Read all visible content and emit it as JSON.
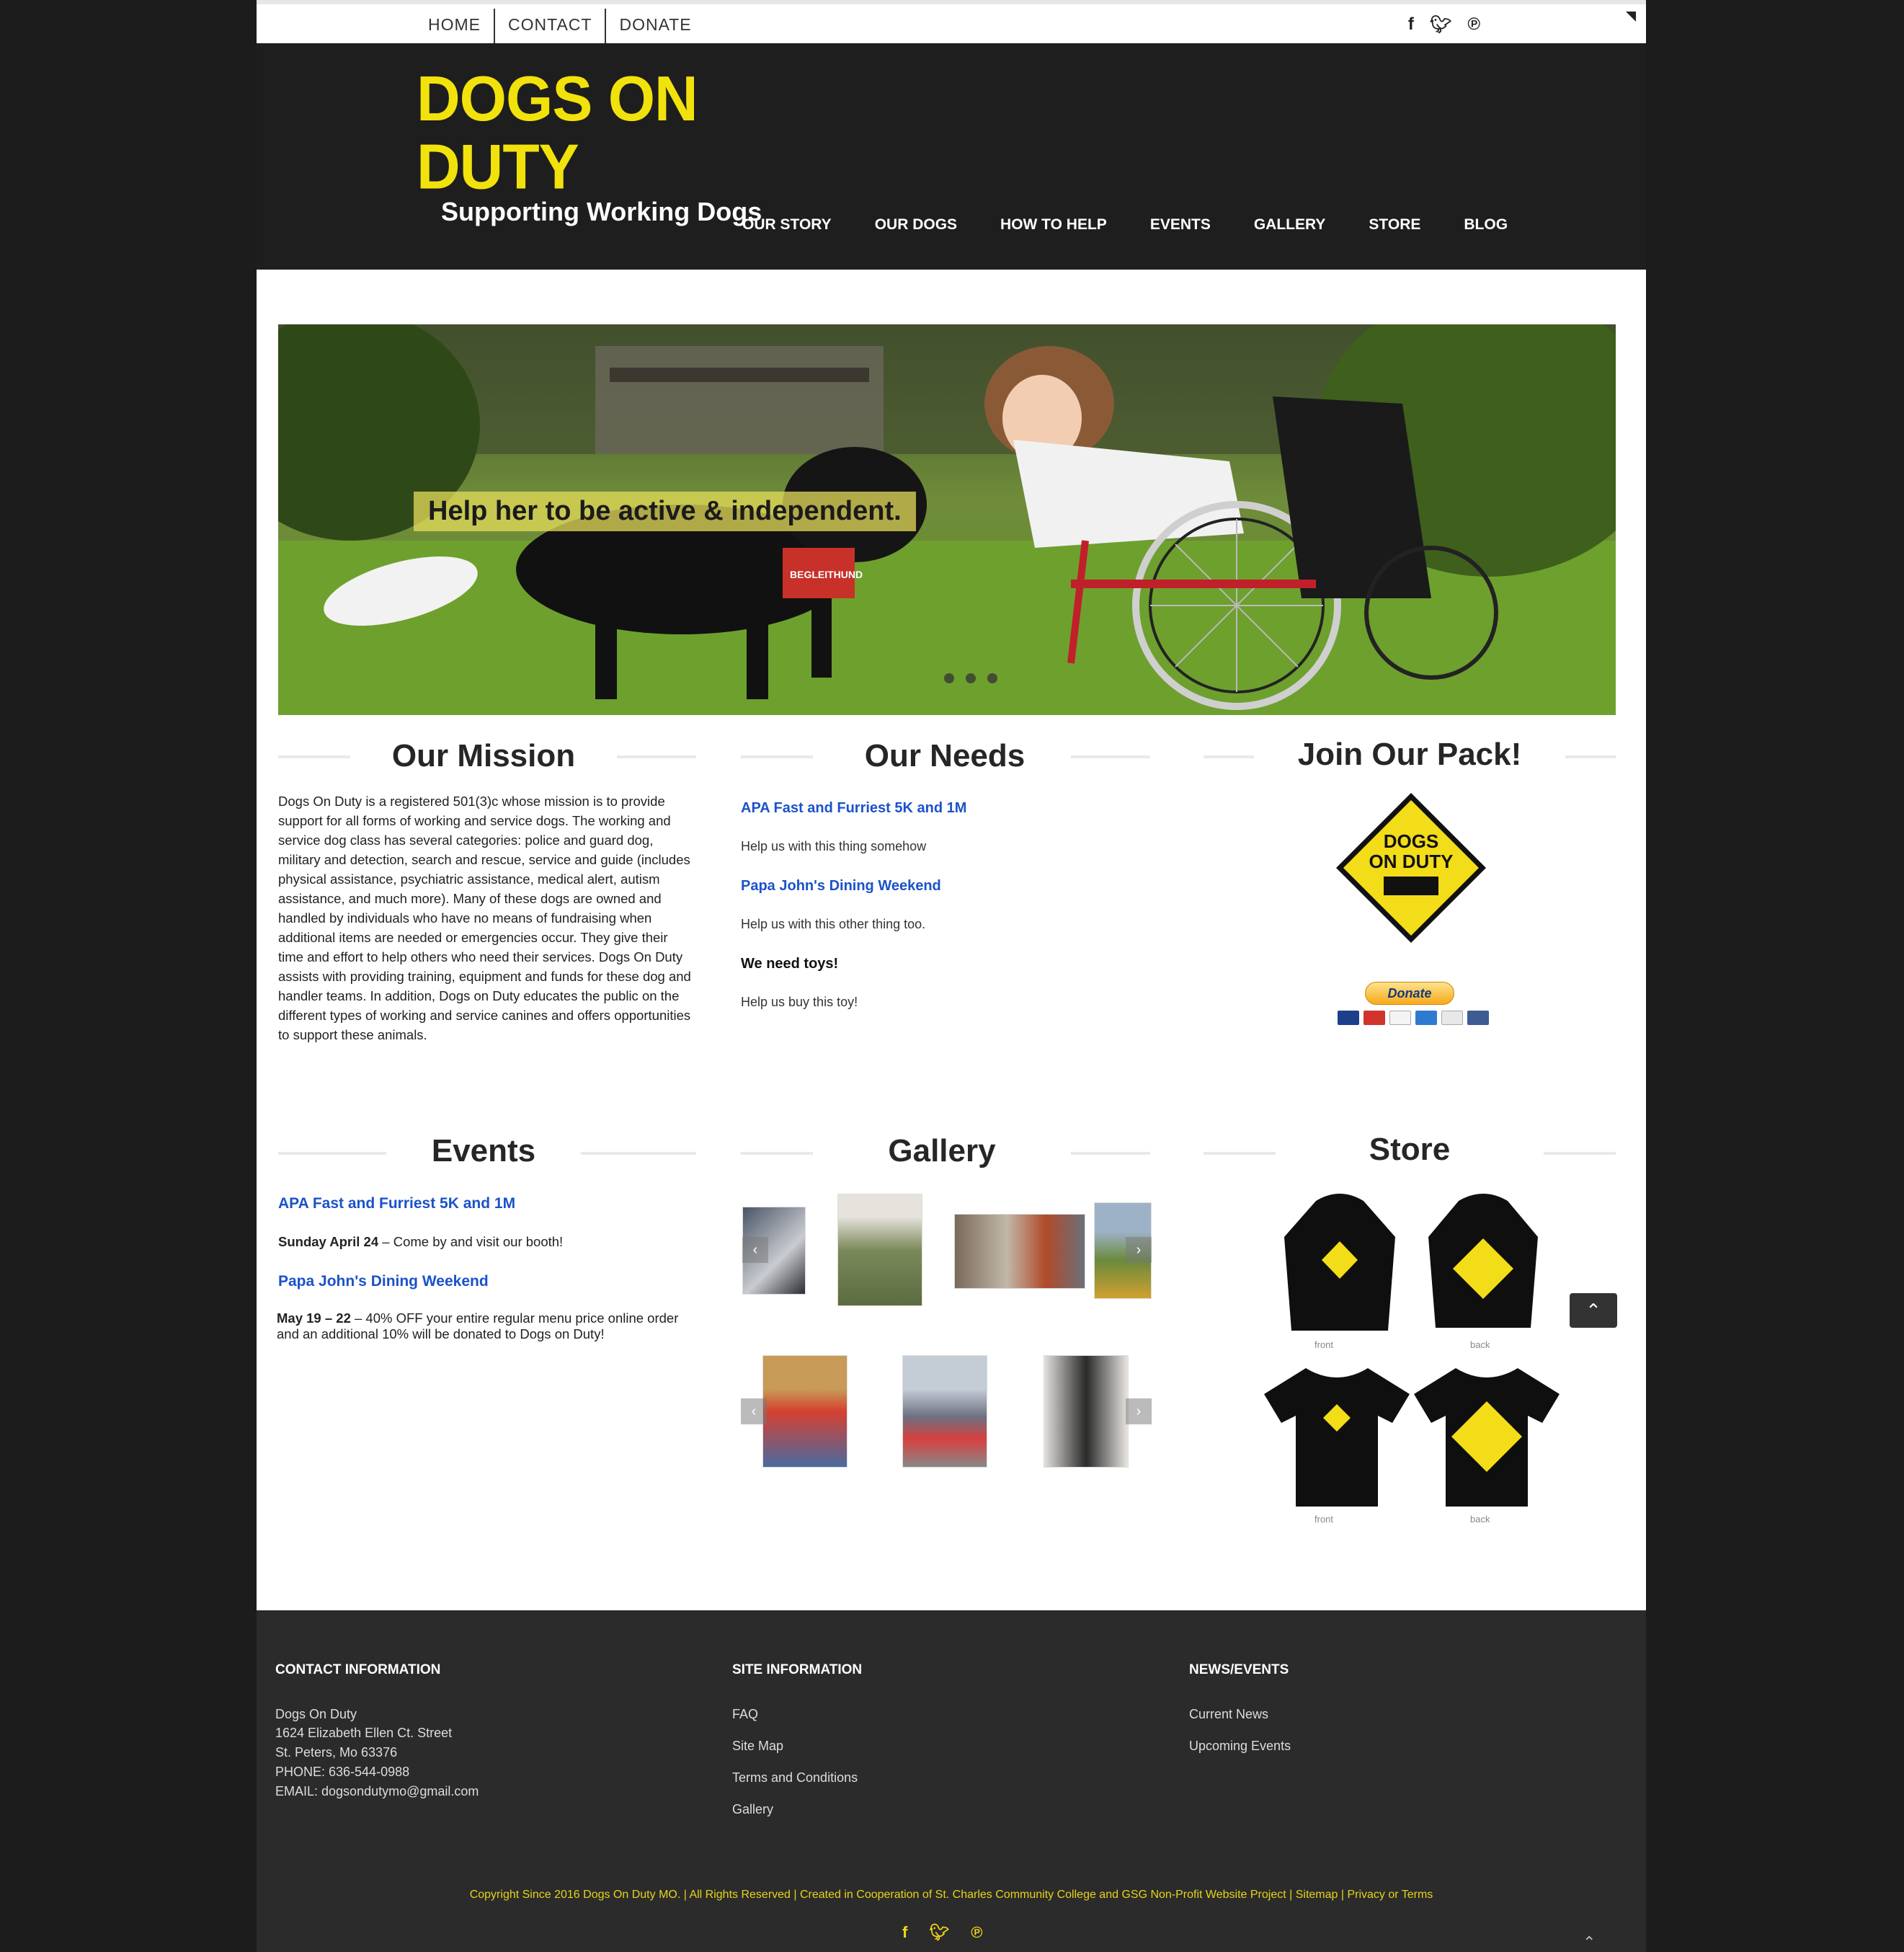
{
  "topbar": {
    "links": [
      "HOME",
      "CONTACT",
      "DONATE"
    ],
    "social_icons": [
      "facebook-icon",
      "twitter-icon",
      "pinterest-icon"
    ]
  },
  "header": {
    "logo_title": "DOGS ON DUTY",
    "logo_subtitle": "Supporting Working Dogs",
    "nav": [
      "OUR STORY",
      "OUR DOGS",
      "HOW TO HELP",
      "EVENTS",
      "GALLERY",
      "STORE",
      "BLOG"
    ]
  },
  "hero": {
    "caption": "Help her to be active & independent.",
    "vest_label": "BEGLEITHUND",
    "slide_count": 3
  },
  "mission": {
    "title": "Our Mission",
    "body": "Dogs On Duty is a registered 501(3)c whose mission is to provide support for all forms of working and service dogs. The working and service dog class has several categories: police and guard dog, military and detection, search and rescue, service and guide (includes physical assistance, psychiatric assistance, medical alert, autism assistance, and much more). Many of these dogs are owned and handled by individuals who have no means of fundraising when additional items are needed or emergencies occur. They give their time and effort to help others who need their services. Dogs On Duty assists with providing training, equipment and funds for these dog and handler teams. In addition, Dogs on Duty educates the public on the different types of working and service canines and offers opportunities to support these animals."
  },
  "needs": {
    "title": "Our Needs",
    "items": [
      {
        "title": "APA Fast and Furriest 5K and 1M",
        "text": "Help us with this thing somehow"
      },
      {
        "title": "Papa John's Dining Weekend",
        "text": "Help us with this other thing too."
      },
      {
        "title": "We need toys!",
        "text": "Help us buy this toy!"
      }
    ]
  },
  "join": {
    "title": "Join Our Pack!",
    "badge_text_1": "DOGS",
    "badge_text_2": "ON DUTY",
    "donate_label": "Donate"
  },
  "events": {
    "title": "Events",
    "items": [
      {
        "title": "APA Fast and Furriest 5K and 1M",
        "date": "Sunday April 24",
        "text": " – Come by and visit our booth!"
      },
      {
        "title": "Papa John's Dining Weekend",
        "date": "May 19 – 22",
        "text": " –  40% OFF your entire regular menu price online order and an additional 10% will be donated to Dogs on Duty!"
      }
    ]
  },
  "gallery": {
    "title": "Gallery"
  },
  "store": {
    "title": "Store",
    "captions": [
      "front",
      "back",
      "front",
      "back"
    ]
  },
  "footer": {
    "contact": {
      "heading": "CONTACT INFORMATION",
      "lines": [
        "Dogs On Duty",
        "1624 Elizabeth Ellen Ct. Street",
        "St. Peters, Mo 63376",
        "PHONE: 636-544-0988",
        "EMAIL: dogsondutymo@gmail.com"
      ]
    },
    "site": {
      "heading": "SITE INFORMATION",
      "links": [
        "FAQ",
        "Site Map",
        "Terms and Conditions",
        "Gallery"
      ]
    },
    "news": {
      "heading": "NEWS/EVENTS",
      "links": [
        "Current News",
        "Upcoming Events"
      ]
    },
    "copyright": "Copyright Since 2016 Dogs On Duty MO. | All Rights Reserved | Created in Cooperation of St. Charles Community College and GSG Non-Profit Website Project | Sitemap | Privacy or Terms"
  },
  "colors": {
    "brand_yellow": "#f2e20c",
    "link_blue": "#1b52c9",
    "header_bg": "#1e1e1e",
    "footer_bg": "#2b2b2b"
  }
}
